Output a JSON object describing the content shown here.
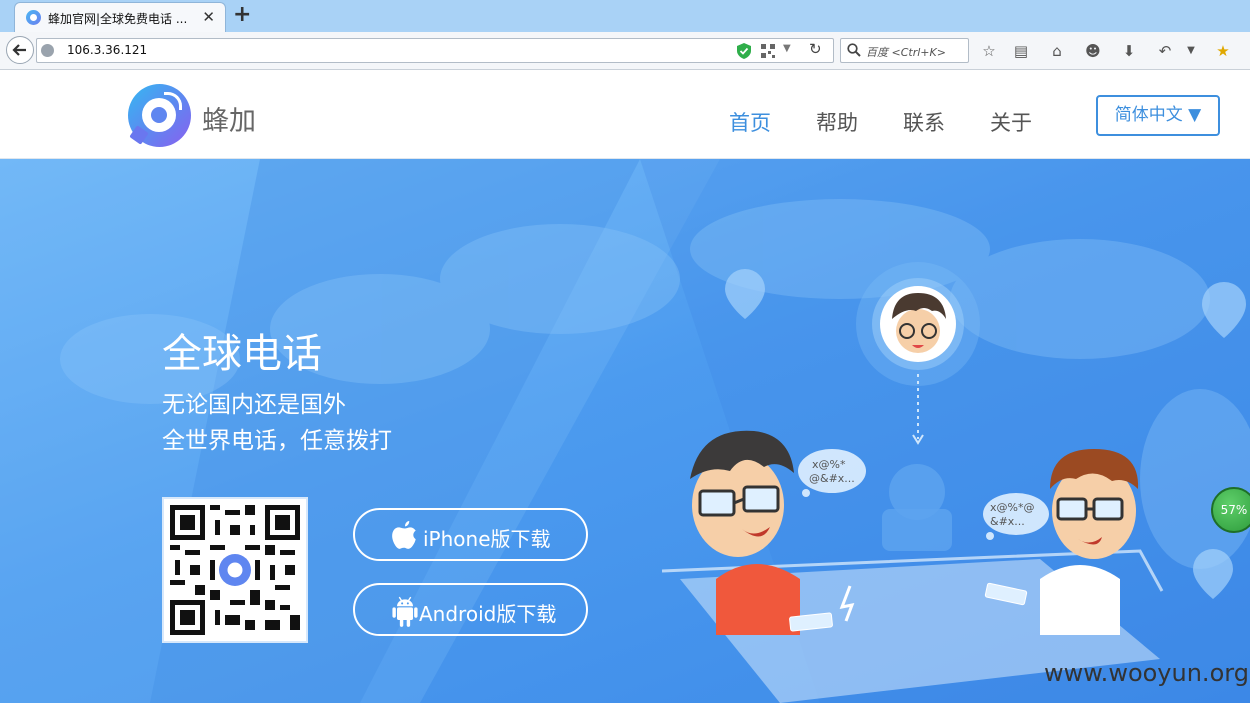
{
  "browser": {
    "tab_title": "蜂加官网|全球免费电话 ...",
    "url": "106.3.36.121",
    "search_placeholder": "百度 <Ctrl+K>"
  },
  "header": {
    "brand": "蜂加",
    "nav": [
      "首页",
      "帮助",
      "联系",
      "关于"
    ],
    "active_nav": "首页",
    "language": "简体中文 ▼"
  },
  "hero": {
    "title": "全球电话",
    "line1": "无论国内还是国外",
    "line2": "全世界电话，任意拨打",
    "iphone_label": "iPhone版下载",
    "android_label": "Android版下载",
    "bubble_left": [
      "x@%*",
      "@&#x..."
    ],
    "bubble_right": [
      "x@%*@",
      "&#x..."
    ],
    "progress_badge": "57%"
  },
  "watermark": "www.wooyun.org",
  "colors": {
    "accent": "#3d8fde",
    "hero_blue": "#4c9bef"
  }
}
